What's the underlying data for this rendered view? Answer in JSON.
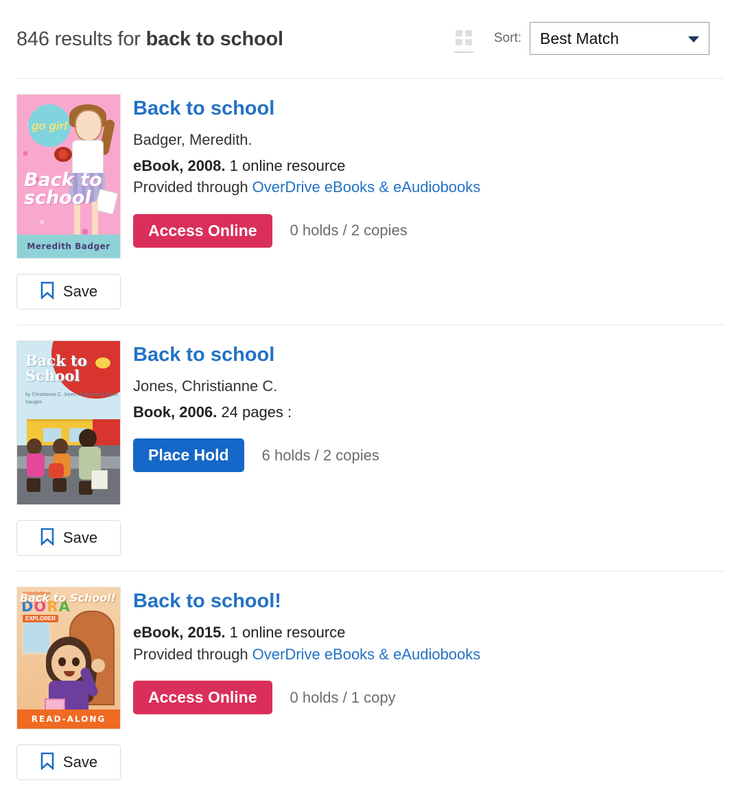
{
  "header": {
    "results_prefix": "846 results for ",
    "query": "back to school",
    "count": "846",
    "grid_icon": "grid-view-icon",
    "sort_label": "Sort:",
    "sort_value": "Best Match",
    "sort_options": [
      "Best Match"
    ],
    "caret_icon": "chevron-down-icon"
  },
  "colors": {
    "title_link": "#2372c4",
    "access_online_button": "#da2f5b",
    "place_hold_button": "#1567c8",
    "bookmark_icon": "#1f6fc4",
    "divider": "#e9e9e9"
  },
  "results": [
    {
      "title": "Back to school",
      "author": "Badger, Meredith.",
      "format_bold": "eBook, 2008.",
      "format_rest": " 1 online resource",
      "provider_prefix": "Provided through ",
      "provider_link": "OverDrive eBooks & eAudiobooks",
      "action_label": "Access Online",
      "availability": "0 holds / 2 copies",
      "save_label": "Save",
      "cover": {
        "name": "book-cover-go-girl-back-to-school",
        "logo_text": "go girl",
        "title_text": "Back to school",
        "author_band": "Meredith Badger"
      }
    },
    {
      "title": "Back to school",
      "author": "Jones, Christianne C.",
      "format_bold": "Book, 2006.",
      "format_rest": " 24 pages :",
      "provider_prefix": "",
      "provider_link": "",
      "action_label": "Place Hold",
      "availability": "6 holds / 2 copies",
      "save_label": "Save",
      "cover": {
        "name": "book-cover-back-to-school-jones",
        "title_text": "Back to School",
        "byline_text": "by Christianne C. Jones\nIllustrated by Ryan Haugen"
      }
    },
    {
      "title": "Back to school!",
      "author": "",
      "format_bold": "eBook, 2015.",
      "format_rest": " 1 online resource",
      "provider_prefix": "Provided through ",
      "provider_link": "OverDrive eBooks & eAudiobooks",
      "action_label": "Access Online",
      "availability": "0 holds / 1 copy",
      "save_label": "Save",
      "cover": {
        "name": "book-cover-dora-back-to-school",
        "brand_text": "nickelodeon",
        "logo_text": "DORA",
        "sub_logo_text": "EXPLORER",
        "title_text": "Back to School!",
        "band_text": "READ-ALONG"
      }
    }
  ]
}
